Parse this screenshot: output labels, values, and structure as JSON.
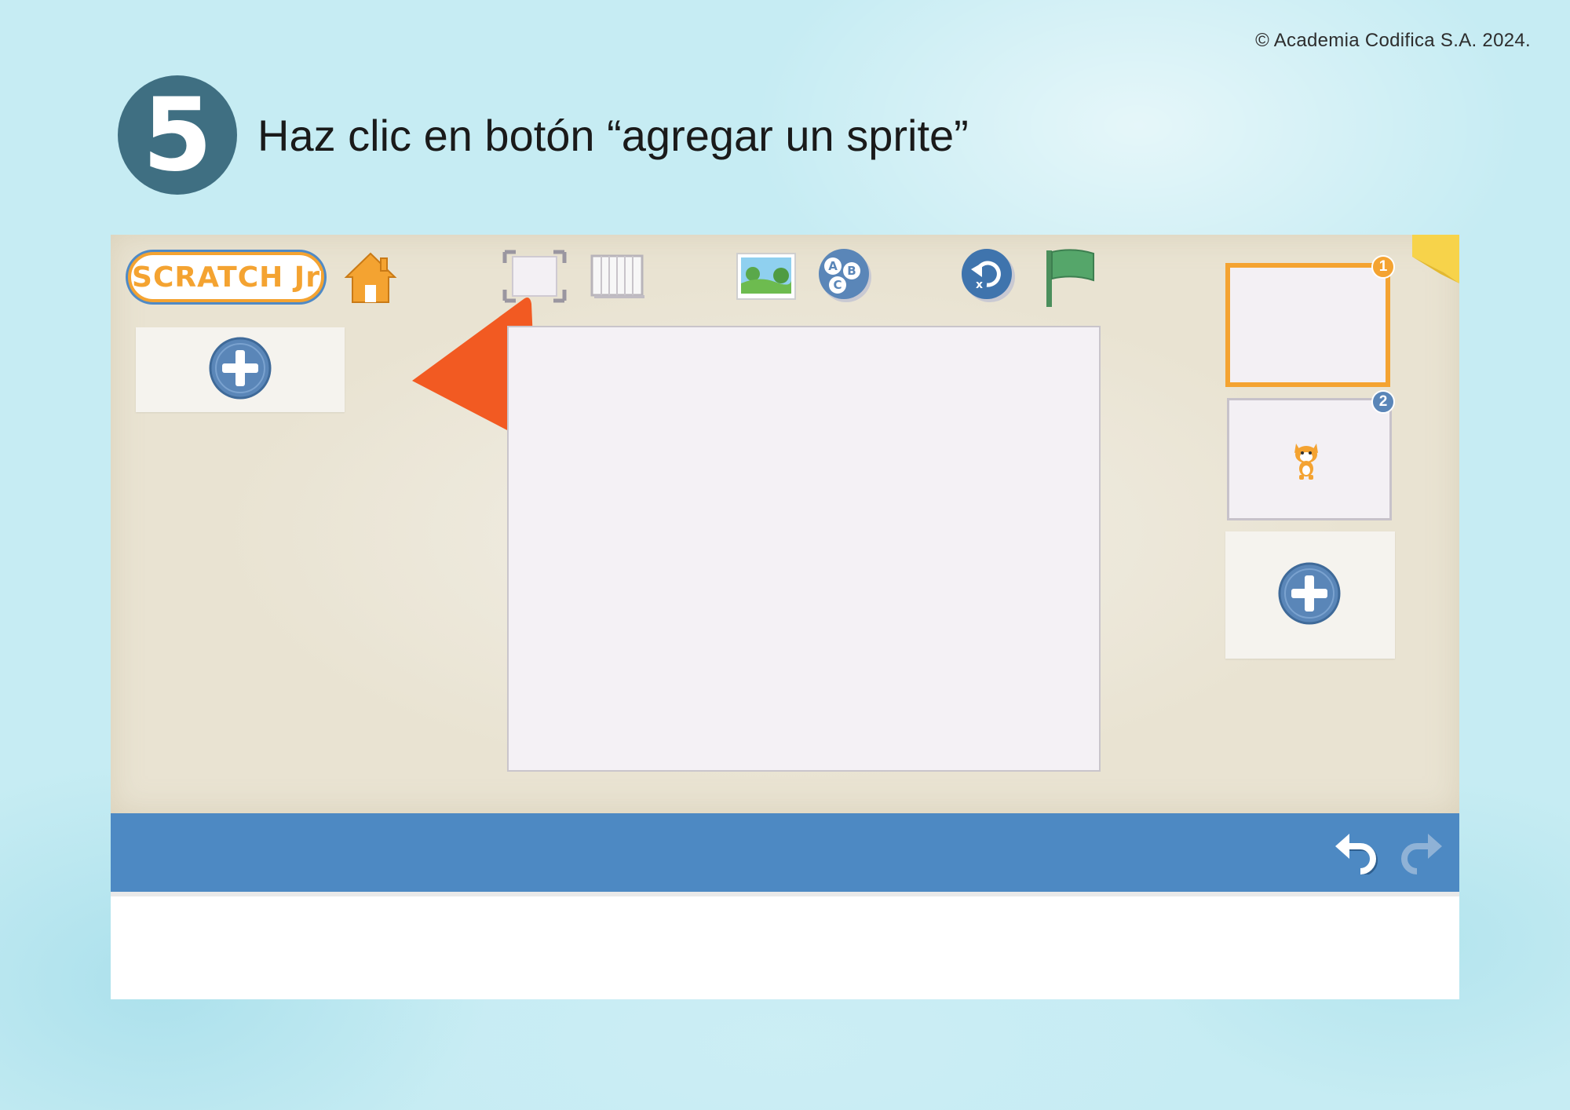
{
  "copyright": "© Academia Codifica S.A. 2024.",
  "step": {
    "number": "5",
    "instruction": "Haz clic en botón “agregar un sprite”"
  },
  "app": {
    "logo_text": "SCRATCH Jr",
    "pages": [
      {
        "number": "1",
        "selected": true
      },
      {
        "number": "2",
        "selected": false
      }
    ],
    "colors": {
      "accent_orange": "#f4a331",
      "bar_blue": "#4d89c3",
      "arrow_orange": "#f25a22",
      "plus_button": "#5a86b8"
    },
    "icons": [
      "home-icon",
      "fullscreen-icon",
      "grid-icon",
      "background-icon",
      "text-icon",
      "reset-icon",
      "green-flag-icon",
      "add-sprite-icon",
      "add-page-icon",
      "cat-sprite-icon",
      "undo-icon",
      "redo-icon",
      "arrow-icon"
    ]
  }
}
